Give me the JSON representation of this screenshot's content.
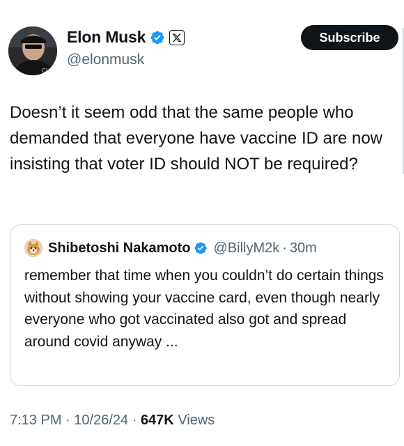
{
  "author": {
    "name": "Elon Musk",
    "handle": "@elonmusk",
    "verified": true,
    "affiliate_badge": "x-logo-icon"
  },
  "subscribe_button": {
    "label": "Subscribe"
  },
  "tweet": {
    "text": "Doesn’t it seem odd that the same people who demanded that everyone have vaccine ID are now insisting that voter ID should NOT be required?"
  },
  "quoted_tweet": {
    "author_name": "Shibetoshi Nakamoto",
    "handle": "@BillyM2k",
    "separator": "·",
    "time": "30m",
    "verified": true,
    "text": "remember that time when you couldn’t do certain things without showing your vaccine card, even though nearly everyone who got vaccinated also got and spread around covid anyway ..."
  },
  "meta": {
    "time": "7:13 PM",
    "date": "10/26/24",
    "separator": "·",
    "views_count": "647K",
    "views_label": "Views"
  },
  "colors": {
    "text_primary": "#0f1419",
    "text_secondary": "#536471",
    "verified_blue": "#1d9bf0",
    "border": "#cfd9de",
    "button_bg": "#0f1419"
  }
}
